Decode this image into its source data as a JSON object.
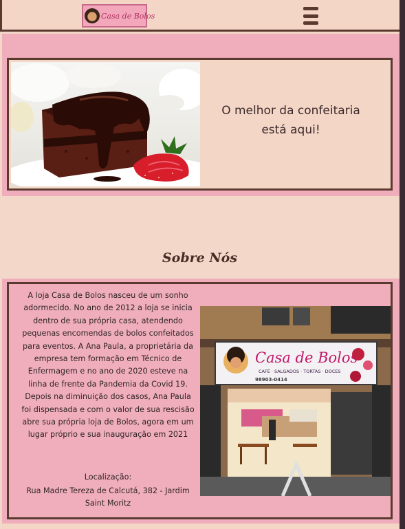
{
  "header": {
    "logo_text": "Casa de Bolos",
    "menu_icon": "hamburger-menu-icon"
  },
  "hero": {
    "image_subject": "chocolate-cake-slice-with-strawberry",
    "tagline": "O melhor da confeitaria está aqui!"
  },
  "about": {
    "title": "Sobre Nós",
    "text": "A loja Casa de Bolos nasceu de um sonho adormecido. No ano de 2012 a loja se inicia dentro de sua própria casa, atendendo pequenas encomendas de bolos confeitados para eventos. A Ana Paula, a proprietária da empresa tem formação em Técnico de Enfermagem e no ano de 2020 esteve na linha de frente da Pandemia da Covid 19. Depois na diminuição dos casos, Ana Paula foi dispensada e com o valor de sua rescisão abre sua própria loja de Bolos, agora em um lugar próprio e sua inauguração em 2021",
    "location_label": "Localização:",
    "location_address": "Rua Madre Tereza de Calcutá, 382 - Jardim Saint Moritz",
    "store_sign": {
      "name": "Casa de Bolos",
      "subtitle": "CAFÉ · SALGADOS · TORTAS · DOCES",
      "phone": "98903-0414"
    }
  },
  "colors": {
    "pink": "#f0aebd",
    "peach": "#f4d6c7",
    "brown": "#5a3a2e"
  }
}
